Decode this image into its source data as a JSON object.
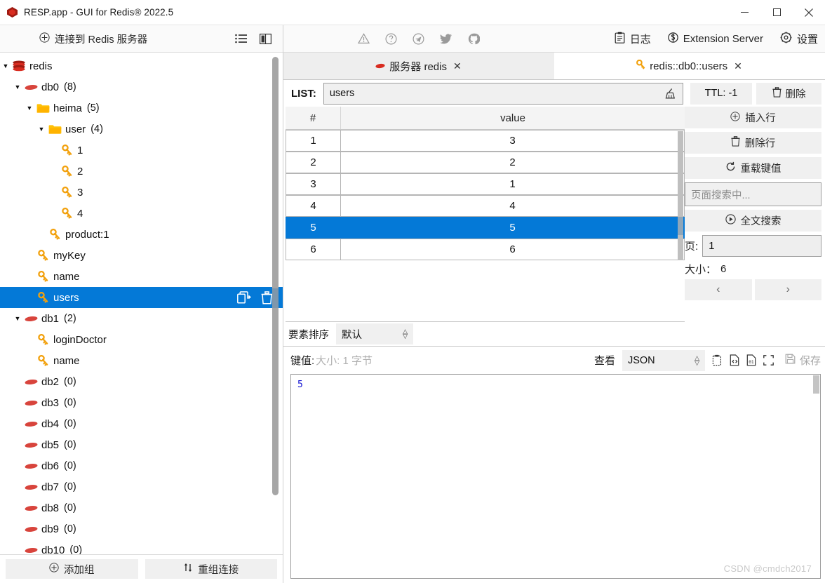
{
  "window": {
    "title": "RESP.app - GUI for Redis® 2022.5",
    "app_icon": "redis-logo-icon",
    "controls": {
      "minimize": "─",
      "maximize": "☐",
      "close": "✕"
    }
  },
  "sidebar": {
    "connect_button": {
      "label": "连接到 Redis 服务器",
      "icon": "plus-circle-icon"
    },
    "tool_icons": [
      {
        "name": "list-view-icon"
      },
      {
        "name": "split-panel-icon"
      }
    ],
    "tree": [
      {
        "label": "redis",
        "count": "",
        "depth": 0,
        "arrow": "▼",
        "icon": "redis-stack-icon",
        "selected": false
      },
      {
        "label": "db0",
        "count": "(8)",
        "depth": 1,
        "arrow": "▼",
        "icon": "db-diamond-icon",
        "selected": false
      },
      {
        "label": "heima",
        "count": "(5)",
        "depth": 2,
        "arrow": "▼",
        "icon": "folder-icon",
        "selected": false
      },
      {
        "label": "user",
        "count": "(4)",
        "depth": 3,
        "arrow": "▼",
        "icon": "folder-icon",
        "selected": false
      },
      {
        "label": "1",
        "count": "",
        "depth": 4,
        "arrow": "",
        "icon": "key-icon",
        "selected": false
      },
      {
        "label": "2",
        "count": "",
        "depth": 4,
        "arrow": "",
        "icon": "key-icon",
        "selected": false
      },
      {
        "label": "3",
        "count": "",
        "depth": 4,
        "arrow": "",
        "icon": "key-icon",
        "selected": false
      },
      {
        "label": "4",
        "count": "",
        "depth": 4,
        "arrow": "",
        "icon": "key-icon",
        "selected": false
      },
      {
        "label": "product:1",
        "count": "",
        "depth": 3,
        "arrow": "",
        "icon": "key-icon",
        "selected": false
      },
      {
        "label": "myKey",
        "count": "",
        "depth": 2,
        "arrow": "",
        "icon": "key-icon",
        "selected": false
      },
      {
        "label": "name",
        "count": "",
        "depth": 2,
        "arrow": "",
        "icon": "key-icon",
        "selected": false
      },
      {
        "label": "users",
        "count": "",
        "depth": 2,
        "arrow": "",
        "icon": "key-icon",
        "selected": true
      },
      {
        "label": "db1",
        "count": "(2)",
        "depth": 1,
        "arrow": "▼",
        "icon": "db-diamond-icon",
        "selected": false
      },
      {
        "label": "loginDoctor",
        "count": "",
        "depth": 2,
        "arrow": "",
        "icon": "key-icon",
        "selected": false
      },
      {
        "label": "name",
        "count": "",
        "depth": 2,
        "arrow": "",
        "icon": "key-icon",
        "selected": false
      },
      {
        "label": "db2",
        "count": "(0)",
        "depth": 1,
        "arrow": "",
        "icon": "db-diamond-icon",
        "selected": false
      },
      {
        "label": "db3",
        "count": "(0)",
        "depth": 1,
        "arrow": "",
        "icon": "db-diamond-icon",
        "selected": false
      },
      {
        "label": "db4",
        "count": "(0)",
        "depth": 1,
        "arrow": "",
        "icon": "db-diamond-icon",
        "selected": false
      },
      {
        "label": "db5",
        "count": "(0)",
        "depth": 1,
        "arrow": "",
        "icon": "db-diamond-icon",
        "selected": false
      },
      {
        "label": "db6",
        "count": "(0)",
        "depth": 1,
        "arrow": "",
        "icon": "db-diamond-icon",
        "selected": false
      },
      {
        "label": "db7",
        "count": "(0)",
        "depth": 1,
        "arrow": "",
        "icon": "db-diamond-icon",
        "selected": false
      },
      {
        "label": "db8",
        "count": "(0)",
        "depth": 1,
        "arrow": "",
        "icon": "db-diamond-icon",
        "selected": false
      },
      {
        "label": "db9",
        "count": "(0)",
        "depth": 1,
        "arrow": "",
        "icon": "db-diamond-icon",
        "selected": false
      },
      {
        "label": "db10",
        "count": "(0)",
        "depth": 1,
        "arrow": "",
        "icon": "db-diamond-icon",
        "selected": false
      }
    ],
    "selected_row_actions": [
      {
        "name": "duplicate-key-icon"
      },
      {
        "name": "delete-key-icon"
      }
    ],
    "footer": {
      "add_group": {
        "label": "添加组",
        "icon": "plus-circle-icon"
      },
      "regroup": {
        "label": "重组连接",
        "icon": "sort-arrows-icon"
      }
    }
  },
  "toolbar": {
    "left_icons": [
      {
        "name": "warning-triangle-icon"
      },
      {
        "name": "help-circle-icon"
      },
      {
        "name": "telegram-icon"
      },
      {
        "name": "twitter-icon"
      },
      {
        "name": "github-icon"
      }
    ],
    "right_items": [
      {
        "label": "日志",
        "icon": "clipboard-log-icon"
      },
      {
        "label": "Extension Server",
        "icon": "extension-server-icon"
      },
      {
        "label": "设置",
        "icon": "gear-icon"
      }
    ]
  },
  "tabs": [
    {
      "label": "服务器 redis",
      "icon": "red-diamond-icon",
      "active": false,
      "close": "✕"
    },
    {
      "label": "redis::db0::users",
      "icon": "key-icon",
      "active": true,
      "close": "✕"
    }
  ],
  "key_view": {
    "type_label": "LIST:",
    "key_name": "users",
    "key_name_clear_icon": "broom-icon",
    "ttl": "TTL: -1",
    "delete_button": {
      "label": "删除",
      "icon": "trash-icon"
    },
    "actions": [
      {
        "label": "插入行",
        "icon": "plus-circle-icon"
      },
      {
        "label": "删除行",
        "icon": "trash-icon"
      },
      {
        "label": "重载键值",
        "icon": "refresh-icon"
      }
    ],
    "search_placeholder": "页面搜索中...",
    "fulltext_search": {
      "label": "全文搜索",
      "icon": "play-circle-icon"
    },
    "page_label": "页:",
    "page_value": "1",
    "size_label": "大小：",
    "size_value": "6",
    "prev_arrow": "‹",
    "next_arrow": "›",
    "table": {
      "columns": [
        "#",
        "value"
      ],
      "rows": [
        {
          "index": "1",
          "value": "3",
          "selected": false
        },
        {
          "index": "2",
          "value": "2",
          "selected": false
        },
        {
          "index": "3",
          "value": "1",
          "selected": false
        },
        {
          "index": "4",
          "value": "4",
          "selected": false
        },
        {
          "index": "5",
          "value": "5",
          "selected": true
        },
        {
          "index": "6",
          "value": "6",
          "selected": false
        }
      ]
    },
    "sort": {
      "label": "要素排序",
      "value": "默认"
    }
  },
  "value_panel": {
    "value_label": "键值:",
    "size_text": "大小: 1 字节",
    "view_label": "查看",
    "view_format": "JSON",
    "icons": [
      {
        "name": "paste-clipboard-icon"
      },
      {
        "name": "code-file-icon"
      },
      {
        "name": "binary-file-icon"
      },
      {
        "name": "fullscreen-icon"
      }
    ],
    "save_button": {
      "label": "保存",
      "icon": "save-disk-icon"
    },
    "editor_content": "5"
  },
  "watermark": "CSDN @cmdch2017",
  "colors": {
    "selection_blue": "#0479d7",
    "key_orange": "#f2a10d",
    "redis_red": "#d82c20",
    "folder_yellow": "#ffc107",
    "editor_text": "#1414d2"
  }
}
